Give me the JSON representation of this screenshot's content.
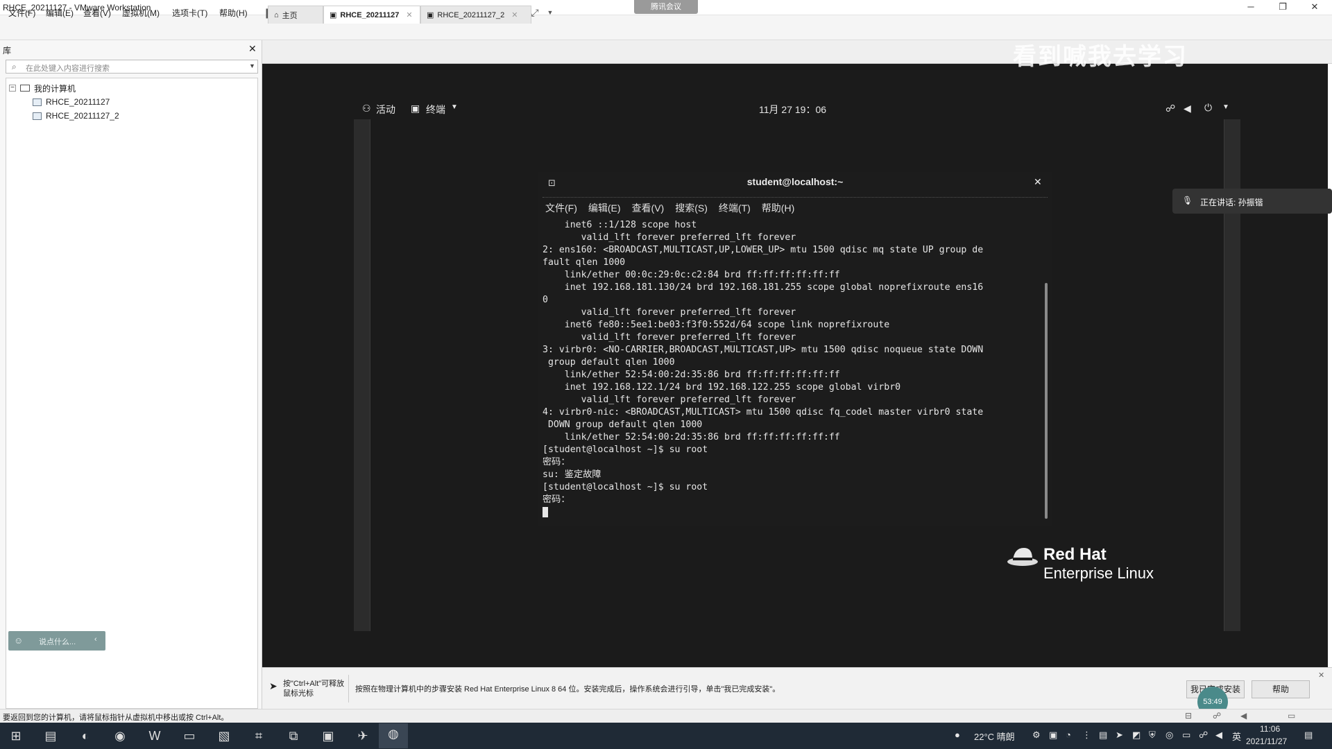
{
  "window": {
    "title": "RHCE_20211127 - VMware Workstation",
    "meeting_tag": "腾讯会议"
  },
  "menu": [
    "文件(F)",
    "编辑(E)",
    "查看(V)",
    "虚拟机(M)",
    "选项卡(T)",
    "帮助(H)"
  ],
  "library": {
    "header": "库",
    "search_placeholder": "在此处键入内容进行搜索",
    "root": "我的计算机",
    "vms": [
      "RHCE_20211127",
      "RHCE_20211127_2"
    ],
    "say_placeholder": "说点什么..."
  },
  "tabs": [
    {
      "label": "主页"
    },
    {
      "label": "RHCE_20211127"
    },
    {
      "label": "RHCE_20211127_2"
    }
  ],
  "watermark": "看到喊我去学习",
  "gnome": {
    "activities": "活动",
    "app": "终端",
    "clock": "11月 27 19：06"
  },
  "terminal": {
    "title": "student@localhost:~",
    "menu": [
      "文件(F)",
      "编辑(E)",
      "查看(V)",
      "搜索(S)",
      "终端(T)",
      "帮助(H)"
    ],
    "lines": [
      "    inet6 ::1/128 scope host",
      "       valid_lft forever preferred_lft forever",
      "2: ens160: <BROADCAST,MULTICAST,UP,LOWER_UP> mtu 1500 qdisc mq state UP group de",
      "fault qlen 1000",
      "    link/ether 00:0c:29:0c:c2:84 brd ff:ff:ff:ff:ff:ff",
      "    inet 192.168.181.130/24 brd 192.168.181.255 scope global noprefixroute ens16",
      "0",
      "       valid_lft forever preferred_lft forever",
      "    inet6 fe80::5ee1:be03:f3f0:552d/64 scope link noprefixroute",
      "       valid_lft forever preferred_lft forever",
      "3: virbr0: <NO-CARRIER,BROADCAST,MULTICAST,UP> mtu 1500 qdisc noqueue state DOWN",
      " group default qlen 1000",
      "    link/ether 52:54:00:2d:35:86 brd ff:ff:ff:ff:ff:ff",
      "    inet 192.168.122.1/24 brd 192.168.122.255 scope global virbr0",
      "       valid_lft forever preferred_lft forever",
      "4: virbr0-nic: <BROADCAST,MULTICAST> mtu 1500 qdisc fq_codel master virbr0 state",
      " DOWN group default qlen 1000",
      "    link/ether 52:54:00:2d:35:86 brd ff:ff:ff:ff:ff:ff",
      "[student@localhost ~]$ su root",
      "密码：",
      "su: 鉴定故障",
      "[student@localhost ~]$ su root",
      "密码："
    ]
  },
  "rhel_logo": {
    "line1": "Red Hat",
    "line2": "Enterprise Linux"
  },
  "speaking": "正在讲话: 孙振锴",
  "hint": {
    "release": "按\"Ctrl+Alt\"可释放鼠标光标",
    "message": "按照在物理计算机中的步骤安装 Red Hat Enterprise Linux 8 64 位。安装完成后，操作系统会进行引导，单击\"我已完成安装\"。",
    "done_button": "我已完成安装",
    "help_button": "帮助"
  },
  "timer": "53:49",
  "status_text": "要返回到您的计算机，请将鼠标指针从虚拟机中移出或按 Ctrl+Alt。",
  "taskbar": {
    "weather": "22°C 晴朗",
    "lang": "英",
    "time": "11:06",
    "date": "2021/11/27"
  },
  "colors": {
    "taskbar": "#1f2a36",
    "console_bg": "#1b1b1b",
    "tray_accent": "#4a8a8a"
  }
}
